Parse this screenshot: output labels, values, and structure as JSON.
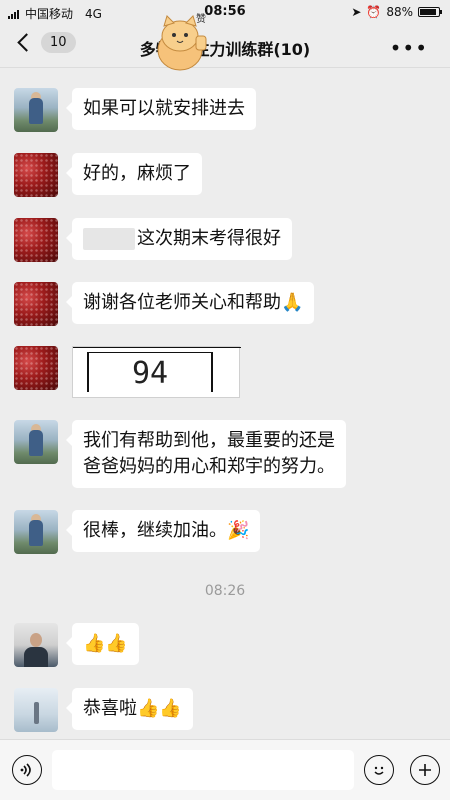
{
  "status_bar": {
    "carrier": "中国移动",
    "network": "4G",
    "time": "08:56",
    "battery": "88%",
    "battery_level": 0.88
  },
  "header": {
    "unread_count": "10",
    "title": "多特  专注力训练群(10)",
    "more": "•••"
  },
  "messages": [
    {
      "avatar": "boy-photo",
      "text": "如果可以就安排进去"
    },
    {
      "avatar": "red-pattern",
      "text": "好的，麻烦了"
    },
    {
      "avatar": "red-pattern",
      "text": "这次期末考得很好"
    },
    {
      "avatar": "red-pattern",
      "text": "谢谢各位老师关心和帮助",
      "emoji": "🙏"
    },
    {
      "avatar": "red-pattern",
      "image_text": "94"
    },
    {
      "avatar": "boy-photo",
      "text_line1": "我们有帮助到他，最重要的还是",
      "text_line2": "爸爸妈妈的用心和郑宇的努力。"
    },
    {
      "avatar": "boy-photo",
      "text": "很棒，继续加油。",
      "emoji": "🎉"
    },
    {
      "avatar": "man-photo",
      "emoji": "👍👍"
    },
    {
      "avatar": "sky-photo",
      "text": "恭喜啦",
      "emoji": "👍👍"
    }
  ],
  "timestamp": "08:26",
  "input_bar": {
    "voice_icon": "voice-icon",
    "emoji_icon": "smiley-icon",
    "plus_icon": "plus-icon"
  },
  "sticker_text": "赞"
}
